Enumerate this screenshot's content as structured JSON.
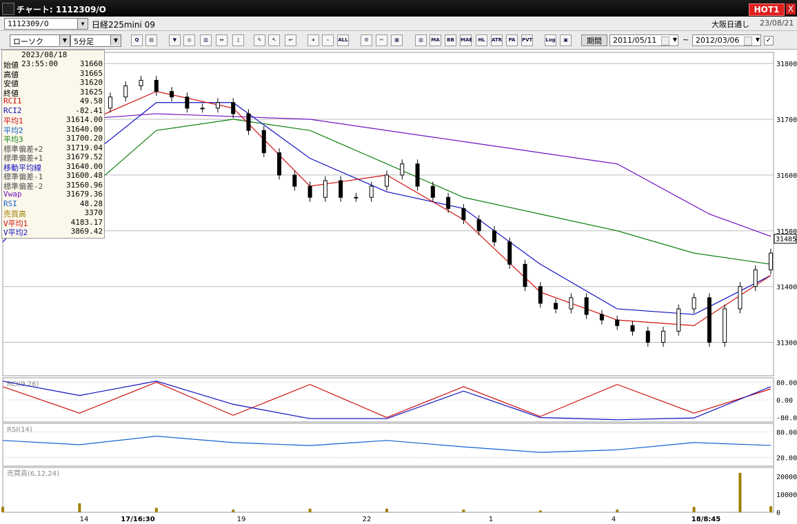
{
  "window": {
    "title": "チャート: 1112309/O",
    "hot_badge": "HOT1",
    "close": "X"
  },
  "header": {
    "symbol": "1112309/O",
    "instrument_name": "日経225mini 09",
    "market": "大阪日通し",
    "date": "23/08/21"
  },
  "toolbar": {
    "chart_type": "ローソク",
    "interval": "5分足",
    "period_label": "期間",
    "date_from": "2011/05/11",
    "date_separator": "~",
    "date_to": "2012/03/06",
    "buttons": [
      {
        "name": "zoom-icon",
        "text": "Q"
      },
      {
        "name": "layout-icon",
        "text": "▤"
      },
      {
        "name": "download-icon",
        "text": "▼"
      },
      {
        "name": "search-icon",
        "text": "◎"
      },
      {
        "name": "chart-icon",
        "text": "▥"
      },
      {
        "name": "arrow-icon",
        "text": "↔"
      },
      {
        "name": "blank-icon",
        "text": "▯"
      },
      {
        "name": "pen-icon",
        "text": "✎"
      },
      {
        "name": "cursor-icon",
        "text": "↖"
      },
      {
        "name": "undo-icon",
        "text": "↩"
      },
      {
        "name": "zoom-in-icon",
        "text": "+"
      },
      {
        "name": "zoom-out-icon",
        "text": "-"
      },
      {
        "name": "all-icon",
        "text": "ALL"
      },
      {
        "name": "settings-icon",
        "text": "⚙"
      },
      {
        "name": "wrench-icon",
        "text": "✂"
      },
      {
        "name": "palette-icon",
        "text": "▦"
      },
      {
        "name": "volume-icon",
        "text": "▥"
      },
      {
        "name": "ma-icon",
        "text": "MA"
      },
      {
        "name": "bb-icon",
        "text": "BB"
      },
      {
        "name": "mae-icon",
        "text": "MAE"
      },
      {
        "name": "hl-icon",
        "text": "HL"
      },
      {
        "name": "atr-icon",
        "text": "ATR"
      },
      {
        "name": "pa-icon",
        "text": "PA"
      },
      {
        "name": "pvt-icon",
        "text": "PVT"
      },
      {
        "name": "log-icon",
        "text": "Log"
      },
      {
        "name": "window-icon",
        "text": "▣"
      }
    ]
  },
  "info_panel": {
    "timestamp": "2023/08/18 23:55:00",
    "rows": [
      {
        "label": "始値",
        "value": "31660",
        "color": "#000000"
      },
      {
        "label": "高値",
        "value": "31665",
        "color": "#000000"
      },
      {
        "label": "安値",
        "value": "31620",
        "color": "#000000"
      },
      {
        "label": "終値",
        "value": "31625",
        "color": "#000000"
      },
      {
        "label": "RCI1",
        "value": "49.58",
        "color": "#d01010"
      },
      {
        "label": "RCI2",
        "value": "-82.41",
        "color": "#1010c0"
      },
      {
        "label": "平均1",
        "value": "31614.00",
        "color": "#d01010"
      },
      {
        "label": "平均2",
        "value": "31640.00",
        "color": "#1060d0"
      },
      {
        "label": "平均3",
        "value": "31700.20",
        "color": "#108010"
      },
      {
        "label": "標準偏差+2",
        "value": "31719.04",
        "color": "#505050"
      },
      {
        "label": "標準偏差+1",
        "value": "31679.52",
        "color": "#505050"
      },
      {
        "label": "移動平均線",
        "value": "31640.00",
        "color": "#1010c0"
      },
      {
        "label": "標準偏差-1",
        "value": "31600.48",
        "color": "#505050"
      },
      {
        "label": "標準偏差-2",
        "value": "31560.96",
        "color": "#505050"
      },
      {
        "label": "Vwap",
        "value": "31679.36",
        "color": "#7010c0"
      },
      {
        "label": "RSI",
        "value": "48.28",
        "color": "#1060d0"
      },
      {
        "label": "売買高",
        "value": "3370",
        "color": "#a08000"
      },
      {
        "label": "V平均1",
        "value": "4183.17",
        "color": "#d01010"
      },
      {
        "label": "V平均2",
        "value": "3869.42",
        "color": "#1010c0"
      }
    ]
  },
  "chart": {
    "price_ticks": [
      "31800",
      "31700",
      "31600",
      "31500",
      "31400",
      "31300"
    ],
    "current_price": "31485",
    "rci_label": "RCI(9,26)",
    "rci_ticks": [
      "80.00",
      "0.00",
      "-80.0"
    ],
    "rsi_label": "RSI(14)",
    "rsi_ticks": [
      "80.00",
      "20.00"
    ],
    "vol_label": "売買高(6,12,24)",
    "vol_ticks": [
      "20000",
      "10000",
      "0"
    ],
    "x_labels": [
      "14",
      "17/16:30",
      "19",
      "22",
      "1",
      "4",
      "18/8:45"
    ]
  },
  "chart_data": {
    "type": "line",
    "title": "",
    "ylim": [
      31240,
      31820
    ],
    "series": [
      {
        "name": "終値",
        "color": "#000000",
        "x": [
          0,
          5,
          10,
          15,
          20,
          25,
          30,
          35,
          40,
          45,
          50,
          55,
          60,
          65,
          70,
          75,
          80,
          85,
          90,
          95,
          100,
          105,
          110,
          115,
          120,
          125,
          130,
          135,
          140,
          145,
          150,
          155,
          160,
          165,
          170,
          175,
          180,
          185,
          190,
          195,
          200,
          205,
          210,
          215,
          220,
          225,
          230,
          235,
          240,
          245,
          250
        ],
        "values": [
          31520,
          31560,
          31600,
          31660,
          31690,
          31700,
          31720,
          31740,
          31760,
          31770,
          31750,
          31740,
          31720,
          31720,
          31730,
          31710,
          31680,
          31640,
          31600,
          31580,
          31560,
          31590,
          31560,
          31560,
          31580,
          31600,
          31620,
          31580,
          31560,
          31540,
          31520,
          31500,
          31480,
          31440,
          31400,
          31370,
          31360,
          31380,
          31350,
          31340,
          31330,
          31320,
          31300,
          31320,
          31360,
          31380,
          31300,
          31360,
          31400,
          31430,
          31460
        ]
      },
      {
        "name": "平均1",
        "color": "#d01010",
        "x": [
          0,
          25,
          50,
          75,
          100,
          125,
          150,
          175,
          200,
          225,
          250
        ],
        "values": [
          31520,
          31690,
          31750,
          31720,
          31580,
          31600,
          31520,
          31390,
          31340,
          31330,
          31420
        ]
      },
      {
        "name": "平均2",
        "color": "#1010c0",
        "x": [
          0,
          25,
          50,
          75,
          100,
          125,
          150,
          175,
          200,
          225,
          250
        ],
        "values": [
          31480,
          31620,
          31730,
          31730,
          31630,
          31570,
          31540,
          31440,
          31360,
          31350,
          31420
        ]
      },
      {
        "name": "平均3",
        "color": "#108010",
        "x": [
          0,
          25,
          50,
          75,
          100,
          125,
          150,
          175,
          200,
          225,
          250
        ],
        "values": [
          31500,
          31560,
          31680,
          31700,
          31680,
          31620,
          31560,
          31530,
          31500,
          31460,
          31440
        ]
      },
      {
        "name": "Vwap",
        "color": "#7010c0",
        "x": [
          0,
          50,
          100,
          150,
          200,
          230,
          250
        ],
        "values": [
          31690,
          31710,
          31700,
          31660,
          31620,
          31530,
          31490
        ]
      },
      {
        "name": "RCI1",
        "color": "#d01010",
        "x": [
          0,
          25,
          50,
          75,
          100,
          125,
          150,
          175,
          200,
          225,
          250
        ],
        "values": [
          60,
          -60,
          80,
          -70,
          70,
          -80,
          60,
          -75,
          70,
          -60,
          49.58
        ]
      },
      {
        "name": "RCI2",
        "color": "#1010c0",
        "x": [
          0,
          25,
          50,
          75,
          100,
          125,
          150,
          175,
          200,
          225,
          250
        ],
        "values": [
          85,
          20,
          85,
          -20,
          -85,
          -85,
          40,
          -80,
          -90,
          -82,
          60
        ]
      },
      {
        "name": "RSI",
        "color": "#1060d0",
        "x": [
          0,
          25,
          50,
          75,
          100,
          125,
          150,
          175,
          200,
          225,
          250
        ],
        "values": [
          60,
          50,
          70,
          55,
          48,
          60,
          45,
          32,
          38,
          55,
          48.28
        ]
      },
      {
        "name": "売買高",
        "color": "#a08000",
        "x": [
          0,
          25,
          50,
          75,
          100,
          125,
          150,
          175,
          200,
          225,
          240,
          250
        ],
        "values": [
          3000,
          5000,
          2500,
          1500,
          2000,
          2000,
          1500,
          1000,
          1500,
          3000,
          22000,
          3370
        ]
      }
    ]
  }
}
